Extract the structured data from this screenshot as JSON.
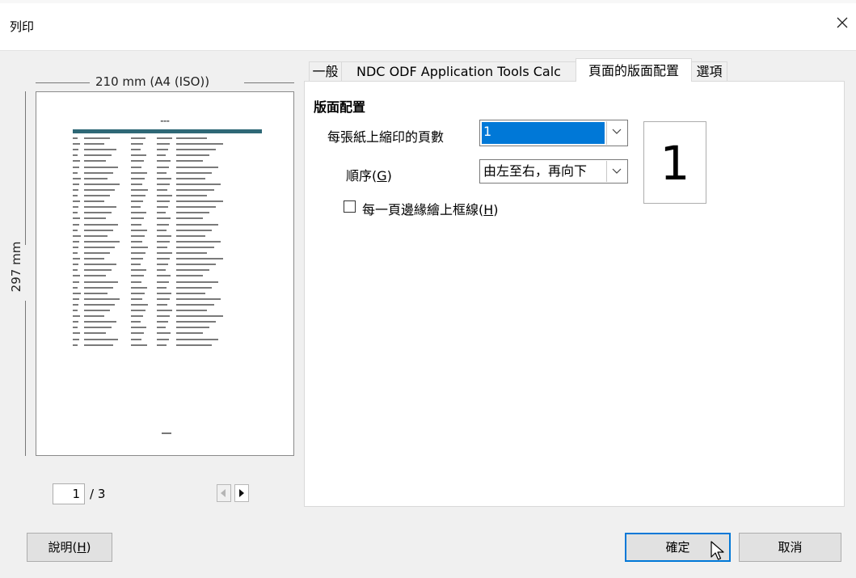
{
  "window": {
    "title": "列印"
  },
  "preview": {
    "width_label": "210 mm (A4 (ISO))",
    "height_label": "297 mm",
    "page_current": "1",
    "page_total": "/ 3"
  },
  "tabs": [
    {
      "label": "一般"
    },
    {
      "label": "NDC ODF Application Tools Calc"
    },
    {
      "label": "頁面的版面配置"
    },
    {
      "label": "選項"
    }
  ],
  "layout_tab": {
    "section_title": "版面配置",
    "pages_per_sheet_label": "每張紙上縮印的頁數",
    "pages_per_sheet_value": "1",
    "order_label_prefix": "順序(",
    "order_label_key": "G",
    "order_label_suffix": ")",
    "order_value": "由左至右，再向下",
    "border_label_prefix": "每一頁邊緣繪上框線(",
    "border_label_key": "H",
    "border_label_suffix": ")",
    "border_checked": false,
    "preview_number": "1"
  },
  "buttons": {
    "help_prefix": "說明(",
    "help_key": "H",
    "help_suffix": ")",
    "ok": "確定",
    "cancel": "取消"
  },
  "colors": {
    "accent": "#0078d7",
    "table_header": "#2e6876"
  }
}
